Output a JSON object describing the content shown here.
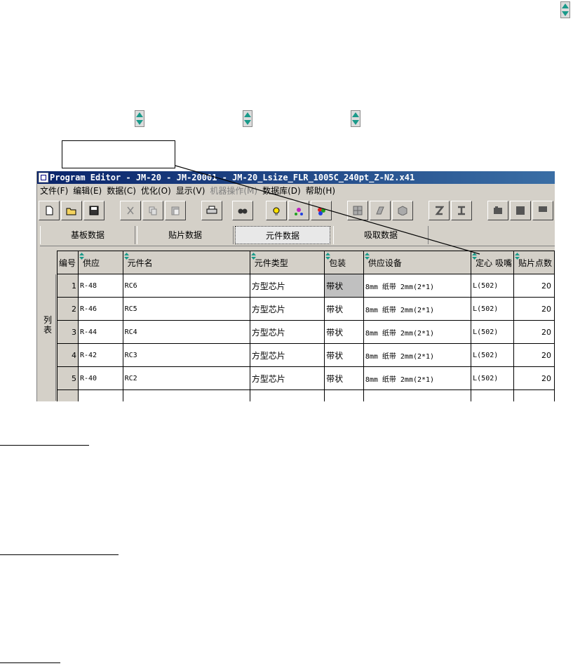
{
  "window": {
    "title": "Program Editor - JM-20 - JM-20001 - JM-20_Lsize_FLR_1005C_240pt_Z-N2.x41"
  },
  "menu": [
    {
      "label": "文件(F)",
      "enabled": true
    },
    {
      "label": "编辑(E)",
      "enabled": true
    },
    {
      "label": "数据(C)",
      "enabled": true
    },
    {
      "label": "优化(O)",
      "enabled": true
    },
    {
      "label": "显示(V)",
      "enabled": true
    },
    {
      "label": "机器操作(M)",
      "enabled": false
    },
    {
      "label": "数据库(D)",
      "enabled": true
    },
    {
      "label": "帮助(H)",
      "enabled": true
    }
  ],
  "toolbar_icons": [
    "new-file-icon",
    "open-folder-icon",
    "save-icon",
    "cut-icon",
    "copy-icon",
    "paste-icon",
    "print-icon",
    "find-icon",
    "lightbulb-icon",
    "components-icon",
    "color-balls-icon",
    "grid-tool-icon",
    "machine-tool-icon",
    "cube-icon",
    "z-shape-icon",
    "i-beam-icon",
    "board-icon",
    "square-icon",
    "partial-tool-icon"
  ],
  "tabs": [
    {
      "label": "基板数据",
      "active": false
    },
    {
      "label": "贴片数据",
      "active": false
    },
    {
      "label": "元件数据",
      "active": true
    },
    {
      "label": "吸取数据",
      "active": false
    }
  ],
  "side_label": "列表",
  "grid": {
    "columns": [
      "编号",
      "供应",
      "元件名",
      "元件类型",
      "包装",
      "供应设备",
      "定心 吸嘴",
      "贴片点数"
    ],
    "rows": [
      {
        "no": "1",
        "feeder": "R-48",
        "name": "RC6",
        "type": "方型芯片",
        "pack": "带状",
        "device": "8mm 纸带 2mm(2*1)",
        "center": "L(502)",
        "count": "20"
      },
      {
        "no": "2",
        "feeder": "R-46",
        "name": "RC5",
        "type": "方型芯片",
        "pack": "带状",
        "device": "8mm 纸带 2mm(2*1)",
        "center": "L(502)",
        "count": "20"
      },
      {
        "no": "3",
        "feeder": "R-44",
        "name": "RC4",
        "type": "方型芯片",
        "pack": "带状",
        "device": "8mm 纸带 2mm(2*1)",
        "center": "L(502)",
        "count": "20"
      },
      {
        "no": "4",
        "feeder": "R-42",
        "name": "RC3",
        "type": "方型芯片",
        "pack": "带状",
        "device": "8mm 纸带 2mm(2*1)",
        "center": "L(502)",
        "count": "20"
      },
      {
        "no": "5",
        "feeder": "R-40",
        "name": "RC2",
        "type": "方型芯片",
        "pack": "带状",
        "device": "8mm 纸带 2mm(2*1)",
        "center": "L(502)",
        "count": "20"
      }
    ]
  },
  "colors": {
    "titlebar_start": "#0a246a",
    "titlebar_end": "#3a6ea5",
    "face": "#d4d0c8",
    "sort_arrow": "#1a9a8a"
  }
}
